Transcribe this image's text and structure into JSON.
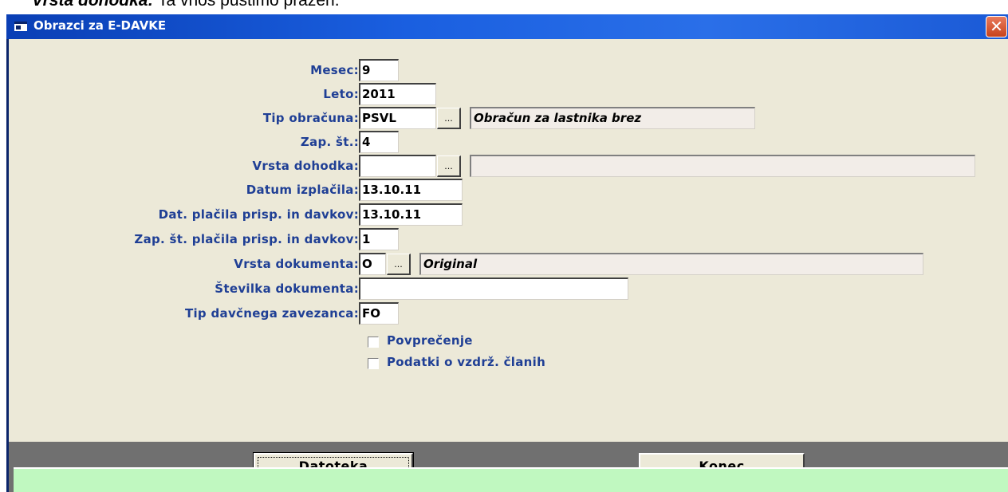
{
  "background_text": {
    "bold": "Vrsta dohodka:",
    "rest": " Ta vnos pustimo prazen."
  },
  "window": {
    "title": "Obrazci za E-DAVKE",
    "close_glyph": "✕"
  },
  "form": {
    "mesec": {
      "label": "Mesec:",
      "value": "9"
    },
    "leto": {
      "label": "Leto:",
      "value": "2011"
    },
    "tip_obracuna": {
      "label": "Tip obračuna:",
      "value": "PSVL",
      "browse": "...",
      "description": "Obračun za lastnika brez"
    },
    "zap_st": {
      "label": "Zap. št.:",
      "value": "4"
    },
    "vrsta_dohodka": {
      "label": "Vrsta dohodka:",
      "value": "",
      "browse": "...",
      "description": ""
    },
    "datum_izplacila": {
      "label": "Datum izplačila:",
      "value": "13.10.11"
    },
    "dat_placila": {
      "label": "Dat. plačila prisp. in davkov:",
      "value": "13.10.11"
    },
    "zap_st_placila": {
      "label": "Zap. št. plačila prisp. in davkov:",
      "value": "1"
    },
    "vrsta_dokumenta": {
      "label": "Vrsta dokumenta:",
      "value": "O",
      "browse": "...",
      "description": "Original"
    },
    "stevilka_dokumenta": {
      "label": "Številka dokumenta:",
      "value": ""
    },
    "tip_zavezanca": {
      "label": "Tip davčnega zavezanca:",
      "value": "FO"
    },
    "povprecenje": {
      "label": "Povprečenje",
      "checked": false
    },
    "podatki_vzdrz": {
      "label": "Podatki o vzdrž. članih",
      "checked": false
    }
  },
  "buttons": {
    "datoteka": {
      "accel": "D",
      "rest": "atoteka"
    },
    "konec": {
      "accel": "K",
      "rest": "onec"
    }
  }
}
